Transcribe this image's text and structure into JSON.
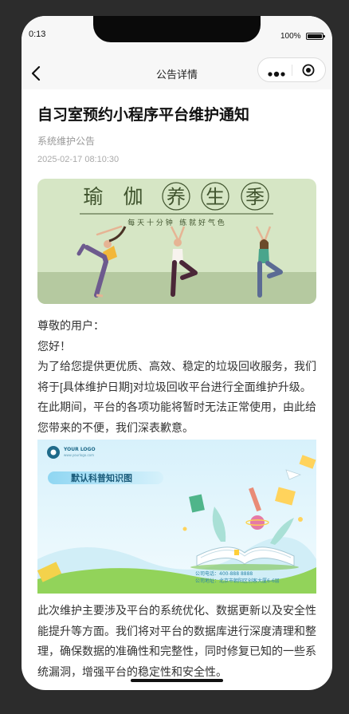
{
  "status_bar": {
    "time": "0:13",
    "battery": "100%"
  },
  "nav": {
    "title": "公告详情"
  },
  "article": {
    "title": "自习室预约小程序平台维护通知",
    "category": "系统维护公告",
    "date": "2025-02-17 08:10:30",
    "banner1": {
      "chars": [
        "瑜",
        "伽",
        "养",
        "生",
        "季"
      ],
      "subtitle": "每 天 十 分 钟   练 就 好 气 色"
    },
    "paragraph1": [
      "尊敬的用户：",
      "您好！",
      "为了给您提供更优质、高效、稳定的垃圾回收服务，我们将于[具体维护日期]对垃圾回收平台进行全面维护升级。在此期间，平台的各项功能将暂时无法正常使用，由此给您带来的不便，我们深表歉意。"
    ],
    "banner2": {
      "logo_title": "YOUR LOGO",
      "logo_sub": "www.yourlogo.com",
      "heading": "默认科普知识图",
      "phone_line": "公司电话：400-888 8888",
      "address_line": "公司地址：北京市朝阳区创客大厦6-6层"
    },
    "paragraph2": "此次维护主要涉及平台的系统优化、数据更新以及安全性能提升等方面。我们将对平台的数据库进行深度清理和整理，确保数据的准确性和完整性，同时修复已知的一些系统漏洞，增强平台的稳定性和安全性。"
  }
}
